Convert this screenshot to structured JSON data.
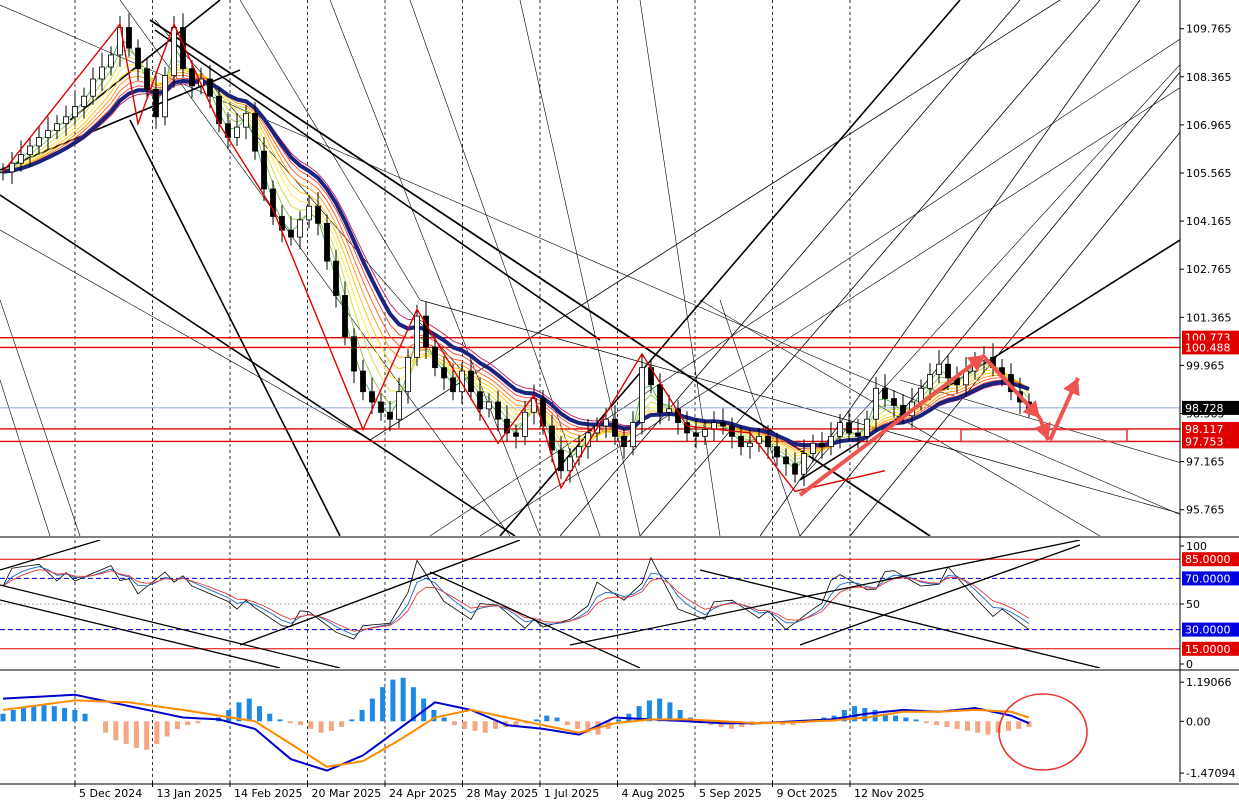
{
  "chart_data": {
    "type": "candlestick",
    "instrument_note": "",
    "x_labels": [
      "5 Dec 2024",
      "13 Jan 2025",
      "14 Feb 2025",
      "20 Mar 2025",
      "24 Apr 2025",
      "28 May 2025",
      "1 Jul 2025",
      "4 Aug 2025",
      "5 Sep 2025",
      "9 Oct 2025",
      "12 Nov 2025"
    ],
    "price_panel": {
      "ylim": [
        95.0,
        110.6
      ],
      "tick_labels": [
        "109.765",
        "108.365",
        "106.965",
        "105.565",
        "104.165",
        "102.765",
        "101.365",
        "99.965",
        "98.565",
        "97.165",
        "95.765"
      ],
      "tick_values": [
        109.765,
        108.365,
        106.965,
        105.565,
        104.165,
        102.765,
        101.365,
        99.965,
        98.565,
        97.165,
        95.765
      ],
      "close_path": [
        [
          0,
          105.6
        ],
        [
          4,
          106.6
        ],
        [
          7,
          107.2
        ],
        [
          9,
          107.8
        ],
        [
          10,
          108.3
        ],
        [
          12,
          109.0
        ],
        [
          13,
          109.8
        ],
        [
          14,
          109.2
        ],
        [
          15,
          108.6
        ],
        [
          16,
          108.0
        ],
        [
          17,
          107.2
        ],
        [
          18,
          108.4
        ],
        [
          19,
          109.8
        ],
        [
          20,
          108.6
        ],
        [
          21,
          108.1
        ],
        [
          22,
          108.3
        ],
        [
          23,
          107.8
        ],
        [
          24,
          107.0
        ],
        [
          25,
          106.6
        ],
        [
          26,
          106.9
        ],
        [
          27,
          107.3
        ],
        [
          28,
          106.2
        ],
        [
          29,
          105.1
        ],
        [
          30,
          104.3
        ],
        [
          31,
          103.9
        ],
        [
          32,
          103.7
        ],
        [
          33,
          104.2
        ],
        [
          34,
          104.6
        ],
        [
          35,
          104.1
        ],
        [
          36,
          103.0
        ],
        [
          37,
          102.0
        ],
        [
          38,
          100.8
        ],
        [
          39,
          99.8
        ],
        [
          40,
          99.2
        ],
        [
          41,
          98.9
        ],
        [
          42,
          98.6
        ],
        [
          43,
          98.4
        ],
        [
          44,
          99.2
        ],
        [
          45,
          100.2
        ],
        [
          46,
          101.4
        ],
        [
          47,
          100.5
        ],
        [
          48,
          99.9
        ],
        [
          49,
          99.6
        ],
        [
          50,
          99.2
        ],
        [
          51,
          99.8
        ],
        [
          52,
          99.2
        ],
        [
          53,
          98.7
        ],
        [
          54,
          98.9
        ],
        [
          55,
          98.4
        ],
        [
          56,
          98.0
        ],
        [
          57,
          97.9
        ],
        [
          58,
          98.6
        ],
        [
          59,
          99.0
        ],
        [
          60,
          98.2
        ],
        [
          61,
          97.5
        ],
        [
          62,
          96.9
        ],
        [
          63,
          97.3
        ],
        [
          64,
          97.6
        ],
        [
          65,
          98.0
        ],
        [
          66,
          98.2
        ],
        [
          67,
          98.4
        ],
        [
          68,
          97.9
        ],
        [
          69,
          97.6
        ],
        [
          70,
          98.3
        ],
        [
          71,
          99.9
        ],
        [
          72,
          99.4
        ],
        [
          73,
          98.6
        ],
        [
          74,
          98.7
        ],
        [
          75,
          98.3
        ],
        [
          76,
          98.0
        ],
        [
          77,
          97.9
        ],
        [
          78,
          98.1
        ],
        [
          79,
          98.3
        ],
        [
          80,
          98.2
        ],
        [
          81,
          97.9
        ],
        [
          82,
          97.6
        ],
        [
          83,
          97.7
        ],
        [
          84,
          97.9
        ],
        [
          85,
          97.6
        ],
        [
          86,
          97.3
        ],
        [
          87,
          97.1
        ],
        [
          88,
          96.8
        ],
        [
          89,
          97.4
        ],
        [
          90,
          97.7
        ],
        [
          91,
          97.6
        ],
        [
          92,
          97.9
        ],
        [
          93,
          98.3
        ],
        [
          94,
          98.0
        ],
        [
          95,
          97.9
        ],
        [
          96,
          98.4
        ],
        [
          97,
          99.3
        ],
        [
          98,
          99.0
        ],
        [
          99,
          98.8
        ],
        [
          100,
          98.5
        ],
        [
          101,
          98.9
        ],
        [
          102,
          99.3
        ],
        [
          103,
          99.7
        ],
        [
          104,
          100.0
        ],
        [
          105,
          99.6
        ],
        [
          106,
          99.4
        ],
        [
          107,
          99.8
        ],
        [
          108,
          100.1
        ],
        [
          109,
          100.2
        ],
        [
          110,
          99.9
        ],
        [
          111,
          99.7
        ],
        [
          112,
          99.2
        ],
        [
          113,
          98.9
        ],
        [
          114,
          98.7
        ]
      ],
      "horizontal_levels": [
        {
          "label": "100.773",
          "value": 100.773,
          "color": "#e00000"
        },
        {
          "label": "100.488",
          "value": 100.488,
          "color": "#e00000"
        },
        {
          "label": "98.117",
          "value": 98.117,
          "color": "#e00000"
        },
        {
          "label": "97.753",
          "value": 97.753,
          "color": "#e00000"
        }
      ],
      "current_price": {
        "label": "98.728",
        "value": 98.728
      },
      "target_zone": {
        "from": 97.75,
        "to": 98.1
      },
      "forecast_arrows": "down to target zone, then up"
    },
    "rsi_panel": {
      "ylim": [
        0,
        100
      ],
      "tick_labels": [
        "100",
        "50",
        "0"
      ],
      "levels": [
        {
          "label": "85.0000",
          "value": 85,
          "color": "#e00000"
        },
        {
          "label": "70.0000",
          "value": 70,
          "color": "#0000e0"
        },
        {
          "label": "30.0000",
          "value": 30,
          "color": "#0000e0"
        },
        {
          "label": "15.0000",
          "value": 15,
          "color": "#e00000"
        }
      ],
      "fast_path": [
        [
          0,
          70
        ],
        [
          4,
          82
        ],
        [
          8,
          64
        ],
        [
          12,
          84
        ],
        [
          15,
          55
        ],
        [
          18,
          78
        ],
        [
          21,
          60
        ],
        [
          25,
          56
        ],
        [
          28,
          44
        ],
        [
          31,
          36
        ],
        [
          34,
          40
        ],
        [
          37,
          30
        ],
        [
          40,
          28
        ],
        [
          43,
          36
        ],
        [
          46,
          78
        ],
        [
          49,
          52
        ],
        [
          52,
          44
        ],
        [
          55,
          48
        ],
        [
          58,
          36
        ],
        [
          60,
          28
        ],
        [
          63,
          40
        ],
        [
          66,
          62
        ],
        [
          69,
          54
        ],
        [
          72,
          80
        ],
        [
          75,
          46
        ],
        [
          78,
          44
        ],
        [
          81,
          52
        ],
        [
          84,
          44
        ],
        [
          87,
          28
        ],
        [
          90,
          50
        ],
        [
          93,
          70
        ],
        [
          96,
          64
        ],
        [
          99,
          72
        ],
        [
          102,
          66
        ],
        [
          105,
          74
        ],
        [
          108,
          56
        ],
        [
          111,
          40
        ],
        [
          114,
          30
        ]
      ]
    },
    "macd_panel": {
      "ylim": [
        -1.6,
        1.3
      ],
      "tick_labels": [
        "1.19066",
        "0.00",
        "-1.47094"
      ],
      "tick_values": [
        1.19066,
        0.0,
        -1.47094
      ],
      "histogram": [
        0.2,
        0.3,
        0.35,
        0.4,
        0.45,
        0.4,
        0.35,
        0.3,
        0.2,
        0.0,
        -0.3,
        -0.5,
        -0.6,
        -0.7,
        -0.75,
        -0.6,
        -0.4,
        -0.2,
        -0.1,
        -0.05,
        0.0,
        0.1,
        0.3,
        0.5,
        0.6,
        0.4,
        0.2,
        0.05,
        -0.05,
        -0.1,
        -0.2,
        -0.3,
        -0.25,
        -0.15,
        0.05,
        0.3,
        0.6,
        0.9,
        1.1,
        1.15,
        0.9,
        0.6,
        0.3,
        0.1,
        -0.1,
        -0.2,
        -0.25,
        -0.3,
        -0.2,
        -0.15,
        -0.1,
        -0.05,
        0.05,
        0.15,
        0.1,
        -0.1,
        -0.2,
        -0.3,
        -0.35,
        -0.2,
        0.05,
        0.2,
        0.4,
        0.55,
        0.6,
        0.5,
        0.3,
        0.1,
        -0.05,
        -0.1,
        -0.15,
        -0.2,
        -0.15,
        -0.1,
        -0.05,
        -0.05,
        -0.1,
        -0.1,
        -0.05,
        0.05,
        0.1,
        0.15,
        0.3,
        0.4,
        0.35,
        0.3,
        0.2,
        0.15,
        0.1,
        0.05,
        -0.05,
        -0.1,
        -0.15,
        -0.2,
        -0.25,
        -0.3,
        -0.35,
        -0.3,
        -0.25,
        -0.2,
        -0.15
      ],
      "macd_path": [
        [
          0,
          0.6
        ],
        [
          8,
          0.7
        ],
        [
          14,
          0.4
        ],
        [
          20,
          0.1
        ],
        [
          24,
          0.05
        ],
        [
          28,
          -0.2
        ],
        [
          32,
          -1.0
        ],
        [
          36,
          -1.3
        ],
        [
          40,
          -0.9
        ],
        [
          44,
          -0.2
        ],
        [
          48,
          0.5
        ],
        [
          52,
          0.3
        ],
        [
          56,
          -0.1
        ],
        [
          60,
          -0.2
        ],
        [
          64,
          -0.35
        ],
        [
          68,
          0.1
        ],
        [
          72,
          0.05
        ],
        [
          76,
          0.0
        ],
        [
          80,
          -0.05
        ],
        [
          84,
          -0.05
        ],
        [
          88,
          0.0
        ],
        [
          92,
          0.05
        ],
        [
          96,
          0.2
        ],
        [
          100,
          0.3
        ],
        [
          104,
          0.25
        ],
        [
          108,
          0.35
        ],
        [
          112,
          0.15
        ],
        [
          114,
          -0.05
        ]
      ],
      "signal_path": [
        [
          0,
          0.3
        ],
        [
          8,
          0.55
        ],
        [
          14,
          0.5
        ],
        [
          20,
          0.3
        ],
        [
          24,
          0.15
        ],
        [
          28,
          0.0
        ],
        [
          32,
          -0.6
        ],
        [
          36,
          -1.2
        ],
        [
          40,
          -1.05
        ],
        [
          44,
          -0.5
        ],
        [
          48,
          0.1
        ],
        [
          52,
          0.3
        ],
        [
          56,
          0.1
        ],
        [
          60,
          -0.1
        ],
        [
          64,
          -0.3
        ],
        [
          68,
          -0.05
        ],
        [
          72,
          0.05
        ],
        [
          76,
          0.05
        ],
        [
          80,
          0.0
        ],
        [
          84,
          -0.05
        ],
        [
          88,
          -0.02
        ],
        [
          92,
          0.02
        ],
        [
          96,
          0.1
        ],
        [
          100,
          0.25
        ],
        [
          104,
          0.25
        ],
        [
          108,
          0.3
        ],
        [
          112,
          0.25
        ],
        [
          114,
          0.1
        ]
      ]
    },
    "colors": {
      "candle_up": "#000000",
      "candle_down": "#000000",
      "ma_thick": "#1a237e",
      "trend_red": "#e00000",
      "hist_up": "#1e88e5",
      "hist_down": "#f4a582",
      "macd_line": "#0000cc",
      "signal_line": "#ff8c00",
      "tag_red": "#e00000",
      "tag_blue": "#0000e0",
      "tag_black": "#000000"
    }
  }
}
